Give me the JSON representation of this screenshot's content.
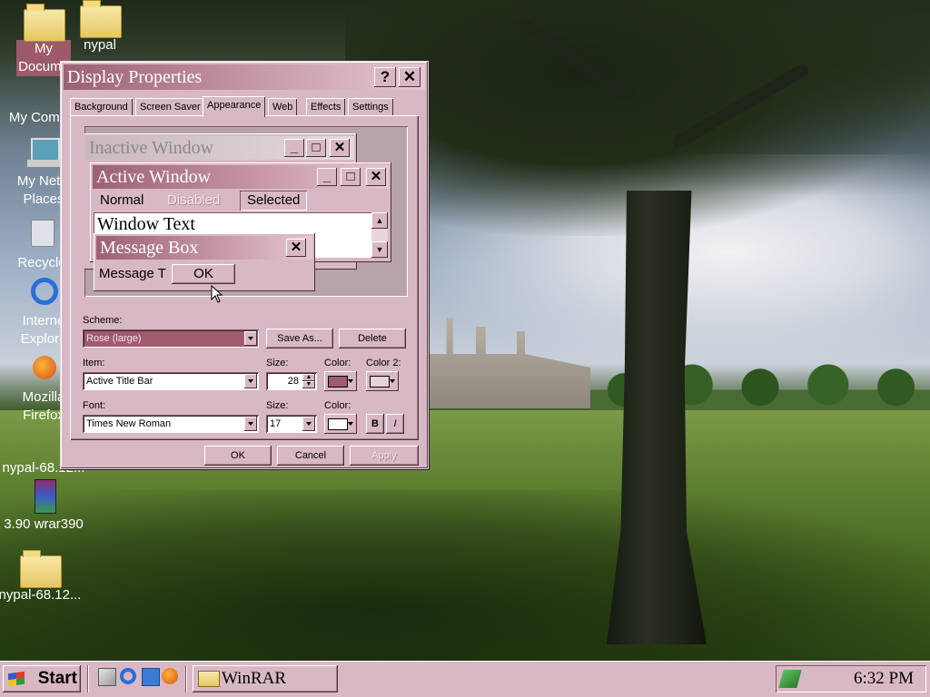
{
  "desktop_icons": [
    {
      "id": "my-documents",
      "label": "My\nDocume"
    },
    {
      "id": "mypal-folder",
      "label": "nypal"
    },
    {
      "id": "my-computer",
      "label": "My Comp"
    },
    {
      "id": "my-network-places",
      "label": "My Netw\nPlaces"
    },
    {
      "id": "recycle-bin",
      "label": "Recycle"
    },
    {
      "id": "internet-explorer",
      "label": "Interne\nExplore"
    },
    {
      "id": "mozilla-firefox",
      "label": "Mozilla\nFirefox"
    },
    {
      "id": "mypal-archive",
      "label": "nypal-68.12..."
    },
    {
      "id": "wrar390",
      "label": "3.90  wrar390"
    },
    {
      "id": "mypal-folder-2",
      "label": "nypal-68.12..."
    }
  ],
  "dialog": {
    "title": "Display Properties",
    "help_label": "?",
    "close_label": "✕",
    "tabs": [
      "Background",
      "Screen Saver",
      "Appearance",
      "Web",
      "Effects",
      "Settings"
    ],
    "active_tab": "Appearance",
    "preview": {
      "inactive_title": "Inactive Window",
      "active_title": "Active Window",
      "menu_normal": "Normal",
      "menu_disabled": "Disabled",
      "menu_selected": "Selected",
      "window_text": "Window Text",
      "msgbox_title": "Message Box",
      "msgbox_text": "Message T",
      "msgbox_ok": "OK"
    },
    "scheme_label": "Scheme:",
    "scheme_value": "Rose (large)",
    "save_as_label": "Save As...",
    "delete_label": "Delete",
    "item_label": "Item:",
    "item_value": "Active Title Bar",
    "item_size_label": "Size:",
    "item_size_value": "28",
    "color_label": "Color:",
    "color2_label": "Color 2:",
    "font_label": "Font:",
    "font_value": "Times New Roman",
    "font_size_label": "Size:",
    "font_size_value": "17",
    "font_color_label": "Color:",
    "bold_label": "B",
    "italic_label": "I",
    "ok_label": "OK",
    "cancel_label": "Cancel",
    "apply_label": "Apply",
    "colors": {
      "color1": "#a05b6f",
      "color2": "#e6d2d9",
      "font_color": "#ffffff"
    }
  },
  "taskbar": {
    "start_label": "Start",
    "quick_launch": [
      "show-desktop-icon",
      "internet-explorer-icon",
      "outlook-express-icon",
      "firefox-icon"
    ],
    "task_button_label": "WinRAR",
    "clock": "6:32 PM"
  }
}
